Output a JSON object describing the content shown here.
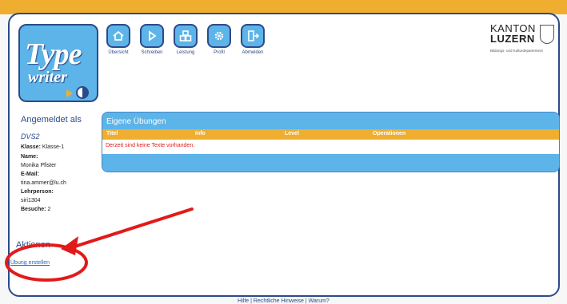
{
  "logo": {
    "line1": "Type",
    "line2": "writer"
  },
  "nav": [
    {
      "label": "Übersicht",
      "icon": "home-icon"
    },
    {
      "label": "Schreiben",
      "icon": "play-icon"
    },
    {
      "label": "Leistung",
      "icon": "chart-icon"
    },
    {
      "label": "Profil",
      "icon": "gear-icon"
    },
    {
      "label": "Abmelden",
      "icon": "logout-icon"
    }
  ],
  "kanton": {
    "line1": "KANTON",
    "line2": "LUZERN",
    "dept": "Bildungs- und Kulturdepartement"
  },
  "sidebar": {
    "heading": "Angemeldet als",
    "username": "DVS2",
    "klasse_label": "Klasse:",
    "klasse_value": "Klasse-1",
    "name_label": "Name:",
    "name_value": "Monika Pfister",
    "email_label": "E-Mail:",
    "email_value": "tina.ammer@lu.ch",
    "lehrperson_label": "Lehrperson:",
    "lehrperson_value": "siri1304",
    "besuche_label": "Besuche:",
    "besuche_value": "2"
  },
  "aktionen": {
    "heading": "Aktionen",
    "link": "Übung erstellen"
  },
  "panel": {
    "title": "Eigene Übungen",
    "columns": [
      "Titel",
      "Info",
      "Level",
      "Operationen"
    ],
    "empty_message": "Derzeit sind keine Texte vorhanden."
  },
  "footer": "Hilfe | Rechtliche Hinweise | Warum?",
  "colors": {
    "accent": "#efae2f",
    "blue": "#5db4e8",
    "navy": "#2c4a8a",
    "annotation": "#e21a1a"
  }
}
